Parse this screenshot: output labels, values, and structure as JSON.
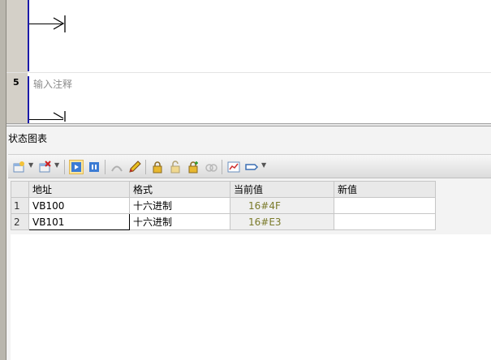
{
  "ladder": {
    "network_number": "5",
    "network_comment": "输入注释"
  },
  "status_chart": {
    "title": "状态图表",
    "toolbar_icons": [
      "insert-row-icon",
      "delete-row-icon",
      "trend-view-icon",
      "single-read-icon",
      "write-all-icon",
      "edit-pencil-icon",
      "force-lock-icon",
      "unforce-icon",
      "unforce-all-icon",
      "read-all-forced-icon",
      "chart-icon",
      "tag-icon"
    ],
    "columns": [
      "地址",
      "格式",
      "当前值",
      "新值"
    ],
    "rows": [
      {
        "index": "1",
        "address": "VB100",
        "format": "十六进制",
        "current": "16#4F",
        "new": ""
      },
      {
        "index": "2",
        "address": "VB101",
        "format": "十六进制",
        "current": "16#E3",
        "new": ""
      }
    ]
  },
  "colors": {
    "rail": "#1a1aa8",
    "active_tool": "#fbe59a",
    "current_value_text": "#7a7a2a"
  }
}
